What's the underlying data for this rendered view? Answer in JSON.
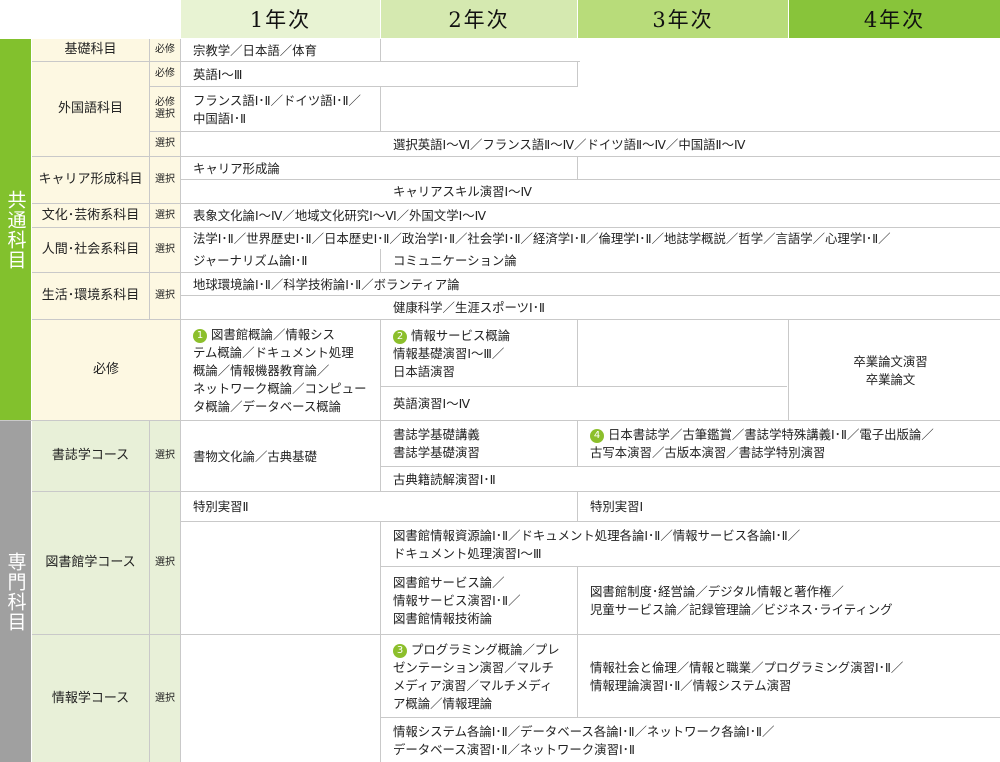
{
  "colors": {
    "year1_header": "#e8f3d3",
    "year2_header": "#d5e9b0",
    "year3_header": "#b8dc7a",
    "year4_header": "#88c43a",
    "common_category": "#82c12d",
    "major_category": "#a0a0a0",
    "common_subject_bg": "#fdf8e2",
    "major_subject_bg": "#e8f0d8",
    "number_badge": "#8cbf2c"
  },
  "years": [
    "1年次",
    "2年次",
    "3年次",
    "4年次"
  ],
  "categories": {
    "common": "共通科目",
    "major": "専門科目"
  },
  "common": {
    "kiso": {
      "subject": "基礎科目",
      "type": "必修",
      "y1": "宗教学／日本語／体育"
    },
    "gaikokugo": {
      "subject": "外国語科目",
      "r1_type": "必修",
      "r1_text": "英語Ⅰ～Ⅲ",
      "r2_type": "必修\n選択",
      "r2_text": "フランス語Ⅰ･Ⅱ／ドイツ語Ⅰ･Ⅱ／\n中国語Ⅰ･Ⅱ",
      "r3_type": "選択",
      "r3_text": "選択英語Ⅰ～Ⅵ／フランス語Ⅱ～Ⅳ／ドイツ語Ⅱ～Ⅳ／中国語Ⅱ～Ⅳ"
    },
    "career": {
      "subject": "キャリア形成科目",
      "type": "選択",
      "r1_text": "キャリア形成論",
      "r2_text": "キャリアスキル演習Ⅰ～Ⅳ"
    },
    "bunka": {
      "subject": "文化･芸術系科目",
      "type": "選択",
      "text": "表象文化論Ⅰ～Ⅳ／地域文化研究Ⅰ～Ⅵ／外国文学Ⅰ～Ⅳ"
    },
    "ningen": {
      "subject": "人間･社会系科目",
      "type": "選択",
      "r1_text": "法学Ⅰ･Ⅱ／世界歴史Ⅰ･Ⅱ／日本歴史Ⅰ･Ⅱ／政治学Ⅰ･Ⅱ／社会学Ⅰ･Ⅱ／経済学Ⅰ･Ⅱ／倫理学Ⅰ･Ⅱ／地誌学概説／哲学／言語学／心理学Ⅰ･Ⅱ／",
      "r2a_text": "ジャーナリズム論Ⅰ･Ⅱ",
      "r2b_text": "コミュニケーション論"
    },
    "seikatsu": {
      "subject": "生活･環境系科目",
      "type": "選択",
      "r1_text": "地球環境論Ⅰ･Ⅱ／科学技術論Ⅰ･Ⅱ／ボランティア論",
      "r2_text": "健康科学／生涯スポーツⅠ･Ⅱ"
    },
    "hisshu": {
      "subject": "必修",
      "y1_num": "1",
      "y1_text": "図書館概論／情報シス\nテム概論／ドキュメント処理\n概論／情報機器教育論／\nネットワーク概論／コンピュー\nタ概論／データベース概論",
      "y2_num": "2",
      "y2_title": "情報サービス概論",
      "y2_text": "情報基礎演習Ⅰ～Ⅲ／\n日本語演習",
      "y2b_text": "英語演習Ⅰ～Ⅳ",
      "y4_text": "卒業論文演習\n卒業論文"
    }
  },
  "major": {
    "shoshi": {
      "subject": "書誌学コース",
      "type": "選択",
      "y1_text": "書物文化論／古典基礎",
      "y2_text": "書誌学基礎講義\n書誌学基礎演習",
      "y34_num": "4",
      "y34_text": "日本書誌学／古筆鑑賞／書誌学特殊講義Ⅰ･Ⅱ／電子出版論／\n古写本演習／古版本演習／書誌学特別演習",
      "r2_text": "古典籍読解演習Ⅰ･Ⅱ"
    },
    "toshokan": {
      "subject": "図書館学コース",
      "type": "選択",
      "r1_y12": "特別実習Ⅱ",
      "r1_y34": "特別実習Ⅰ",
      "r2_text": "図書館情報資源論Ⅰ･Ⅱ／ドキュメント処理各論Ⅰ･Ⅱ／情報サービス各論Ⅰ･Ⅱ／\nドキュメント処理演習Ⅰ～Ⅲ",
      "r3_y2": "図書館サービス論／\n情報サービス演習Ⅰ･Ⅱ／\n図書館情報技術論",
      "r3_y34": "図書館制度･経営論／デジタル情報と著作権／\n児童サービス論／記録管理論／ビジネス･ライティング"
    },
    "joho": {
      "subject": "情報学コース",
      "type": "選択",
      "y2_num": "3",
      "y2_text": "プログラミング概論／プレ\nゼンテーション演習／マルチ\nメディア演習／マルチメディ\nア概論／情報理論",
      "y34_text": "情報社会と倫理／情報と職業／プログラミング演習Ⅰ･Ⅱ／\n情報理論演習Ⅰ･Ⅱ／情報システム演習",
      "r2_text": "情報システム各論Ⅰ･Ⅱ／データベース各論Ⅰ･Ⅱ／ネットワーク各論Ⅰ･Ⅱ／\nデータベース演習Ⅰ･Ⅱ／ネットワーク演習Ⅰ･Ⅱ"
    }
  }
}
